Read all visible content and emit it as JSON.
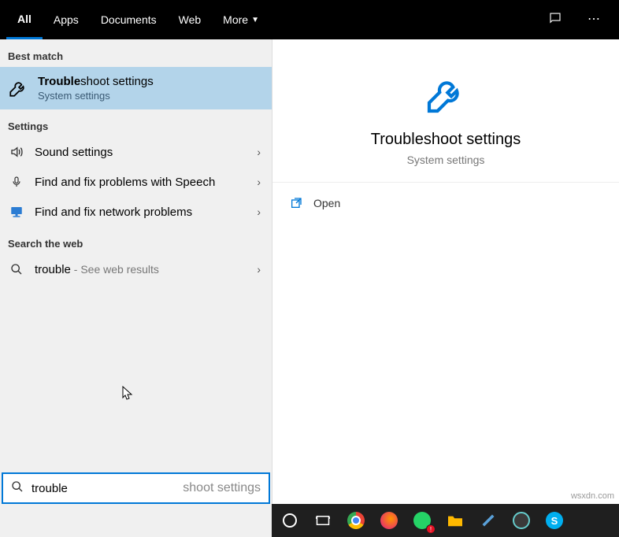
{
  "tabs": {
    "all": "All",
    "apps": "Apps",
    "documents": "Documents",
    "web": "Web",
    "more": "More"
  },
  "sections": {
    "best_match": "Best match",
    "settings": "Settings",
    "search_web": "Search the web"
  },
  "best": {
    "title_bold": "Trouble",
    "title_rest": "shoot settings",
    "sub": "System settings"
  },
  "items": {
    "sound": "Sound settings",
    "speech": "Find and fix problems with Speech",
    "network": "Find and fix network problems",
    "web_term": "trouble",
    "web_suffix": " - See web results"
  },
  "detail": {
    "title": "Troubleshoot settings",
    "sub": "System settings",
    "open": "Open"
  },
  "search": {
    "value": "trouble",
    "placeholder": "shoot settings"
  },
  "watermark": "wsxdn.com"
}
